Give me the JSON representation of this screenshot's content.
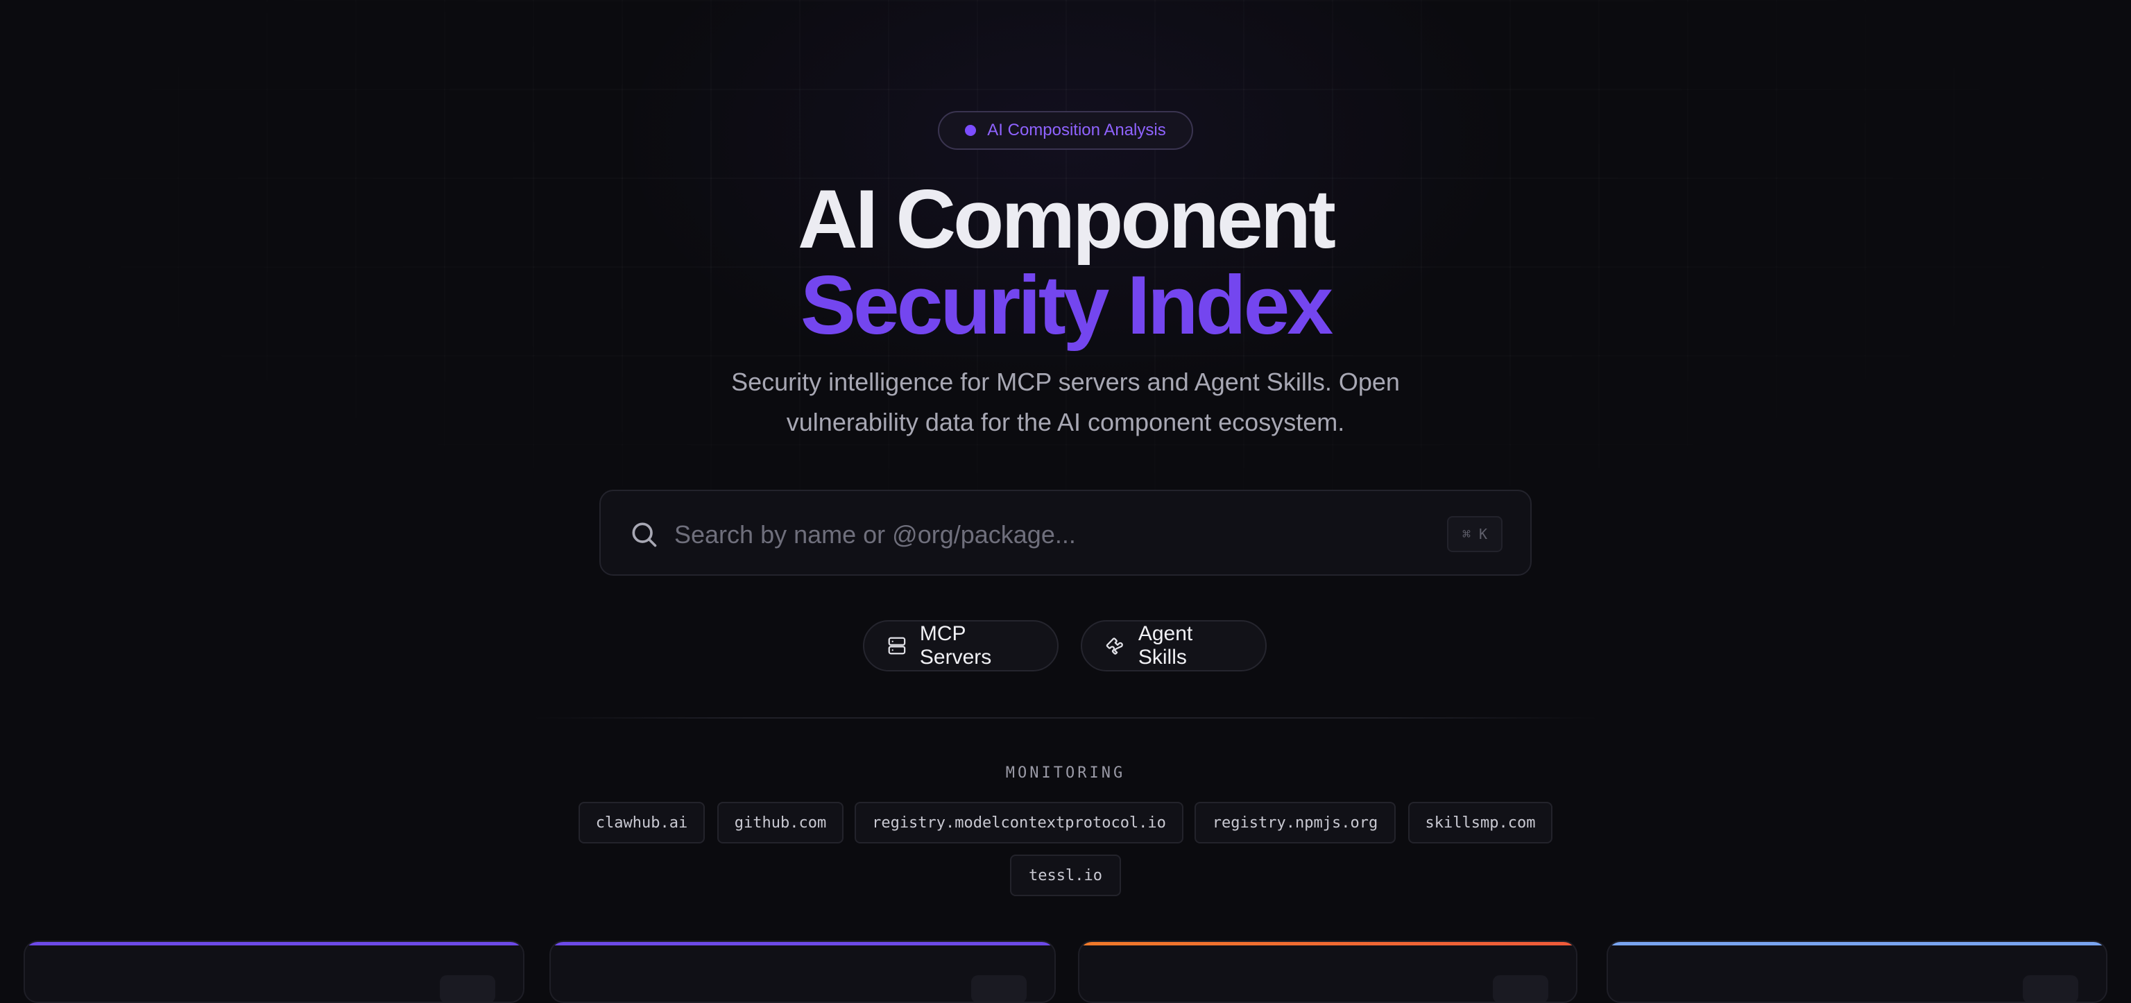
{
  "hero": {
    "badge_label": "AI Composition Analysis",
    "title_line1": "AI Component",
    "title_line2": "Security Index",
    "subtitle": "Security intelligence for MCP servers and Agent Skills. Open vulnerability data for the AI component ecosystem."
  },
  "search": {
    "placeholder": "Search by name or @org/package...",
    "value": "",
    "shortcut": "⌘ K",
    "icon": "search-icon"
  },
  "filters": [
    {
      "label": "MCP Servers",
      "icon": "server-icon"
    },
    {
      "label": "Agent Skills",
      "icon": "puzzle-icon"
    }
  ],
  "monitoring": {
    "label": "MONITORING",
    "sources": [
      "clawhub.ai",
      "github.com",
      "registry.modelcontextprotocol.io",
      "registry.npmjs.org",
      "skillsmp.com",
      "tessl.io"
    ]
  },
  "cards": [
    {
      "accent": "#6d4ae8"
    },
    {
      "accent": "#6d4ae8"
    },
    {
      "accent": "#f07a2a"
    },
    {
      "accent": "#7aa5f0"
    }
  ],
  "colors": {
    "background": "#0b0b0f",
    "accent_purple": "#7446ef",
    "text_primary": "#ececf2",
    "text_muted": "#a8a8b4"
  }
}
